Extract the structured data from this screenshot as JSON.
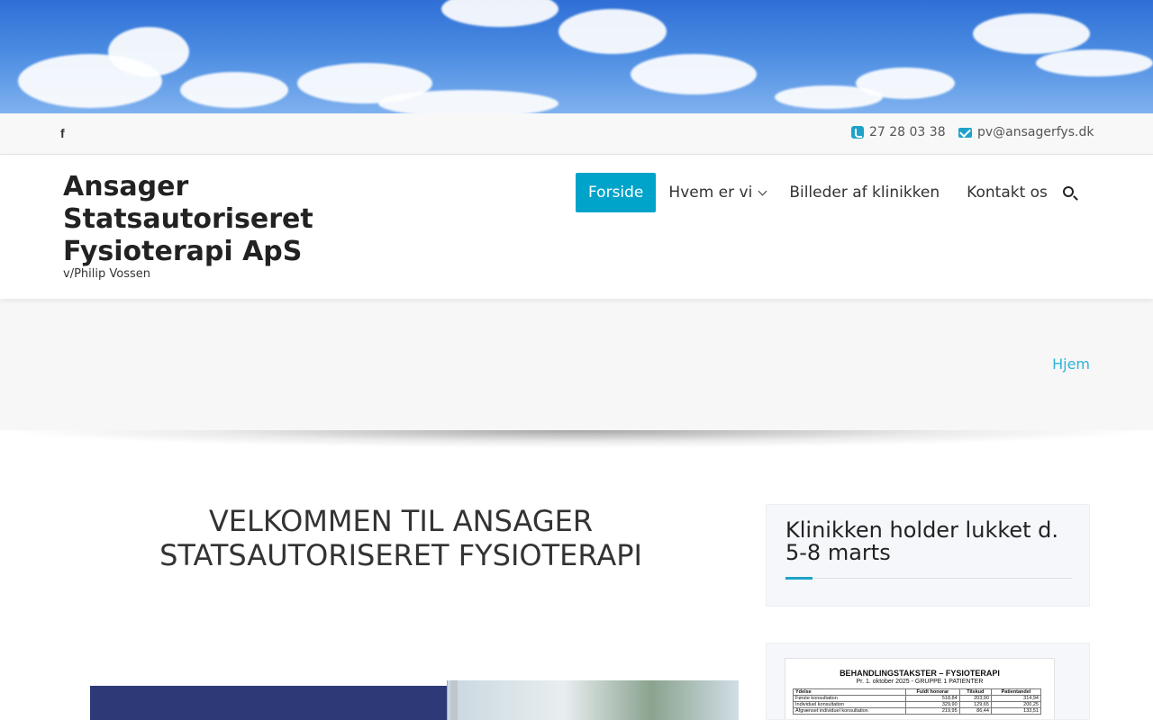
{
  "topbar": {
    "facebook_icon": "facebook-icon",
    "phone": "27 28 03 38",
    "email": "pv@ansagerfys.dk"
  },
  "header": {
    "title": "Ansager Statsautoriseret Fysioterapi ApS",
    "tagline": "v/Philip Vossen"
  },
  "nav": {
    "items": [
      {
        "label": "Forside",
        "active": true
      },
      {
        "label": "Hvem er vi",
        "has_dropdown": true
      },
      {
        "label": "Billeder af klinikken"
      },
      {
        "label": "Kontakt os"
      }
    ],
    "search_icon": "search-icon"
  },
  "breadcrumb": {
    "home": "Hjem"
  },
  "main": {
    "heading": "VELKOMMEN TIL ANSAGER STATSAUTORISERET FYSIOTERAPI"
  },
  "sidebar": {
    "notice_title": "Klinikken holder lukket d. 5-8 marts",
    "price_doc": {
      "title": "BEHANDLINGSTAKSTER – FYSIOTERAPI",
      "subtitle": "Pr. 1. oktober 2025 - GRUPPE 1 PATIENTER",
      "columns": [
        "Ydelse",
        "Fuldt honorar",
        "Tilskud",
        "Patientandel"
      ],
      "rows": [
        [
          "Første konsultation",
          "518,84",
          "203,90",
          "314,94"
        ],
        [
          "Individuel konsultation",
          "329,90",
          "129,65",
          "200,25"
        ],
        [
          "Afgrænset individuel konsultation",
          "219,95",
          "86,44",
          "133,51"
        ]
      ]
    }
  },
  "colors": {
    "accent": "#00a3c9",
    "link": "#2fb3d8"
  }
}
